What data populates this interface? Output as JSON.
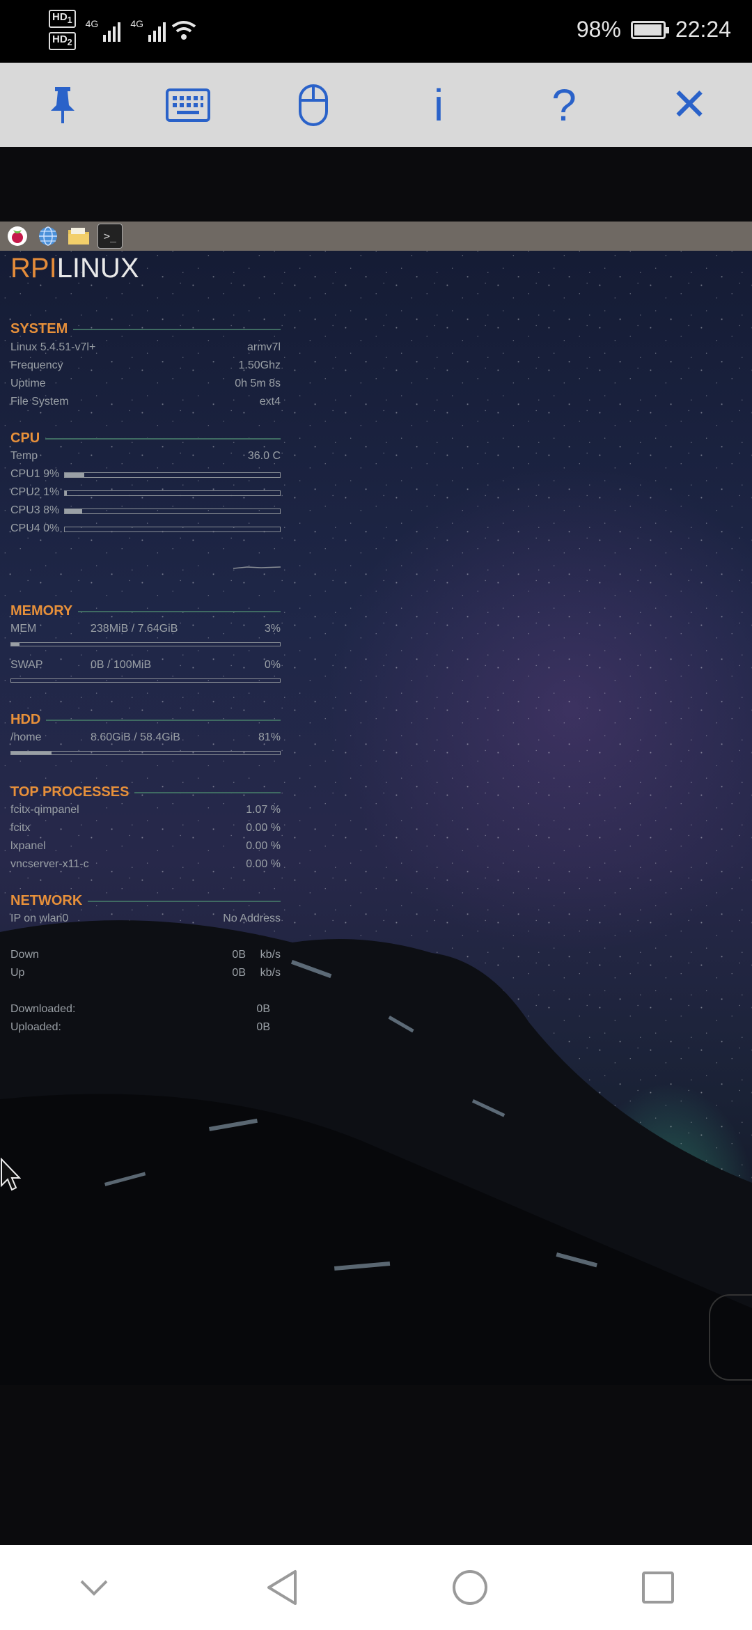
{
  "status_bar": {
    "sim1": "HD",
    "sim1_slot": "1",
    "sim2": "HD",
    "sim2_slot": "2",
    "network1": "4G",
    "network2": "4G",
    "battery_percent": "98%",
    "battery_level": 0.98,
    "time": "22:24"
  },
  "toolbar": {
    "buttons": [
      {
        "icon": "pin-icon"
      },
      {
        "icon": "keyboard-icon"
      },
      {
        "icon": "mouse-icon"
      },
      {
        "icon": "info-icon",
        "glyph": "i"
      },
      {
        "icon": "help-icon",
        "glyph": "?"
      },
      {
        "icon": "close-icon",
        "glyph": "✕"
      }
    ]
  },
  "desktop": {
    "taskbar": [
      {
        "icon": "raspberry-icon"
      },
      {
        "icon": "globe-icon"
      },
      {
        "icon": "folder-icon"
      },
      {
        "icon": "terminal-icon",
        "glyph": ">_"
      }
    ],
    "brand": {
      "part1": "RPI",
      "part2": "LINUX"
    },
    "system": {
      "title": "SYSTEM",
      "rows": [
        {
          "label": "Linux 5.4.51-v7l+",
          "value": "armv7l"
        },
        {
          "label": "Frequency",
          "value": "1.50Ghz"
        },
        {
          "label": "Uptime",
          "value": "0h 5m 8s"
        },
        {
          "label": "File System",
          "value": "ext4"
        }
      ]
    },
    "cpu": {
      "title": "CPU",
      "temp_label": "Temp",
      "temp_value": "36.0 C",
      "cores": [
        {
          "label": "CPU1 9%",
          "level": 0.09
        },
        {
          "label": "CPU2 1%",
          "level": 0.01
        },
        {
          "label": "CPU3 8%",
          "level": 0.08
        },
        {
          "label": "CPU4 0%",
          "level": 0.0
        }
      ]
    },
    "memory": {
      "title": "MEMORY",
      "mem_label": "MEM",
      "mem_used": "238MiB / 7.64GiB",
      "mem_percent": "3%",
      "mem_level": 0.03,
      "swap_label": "SWAP",
      "swap_used": "0B / 100MiB",
      "swap_percent": "0%",
      "swap_level": 0.0
    },
    "hdd": {
      "title": "HDD",
      "mount": "/home",
      "used": "8.60GiB / 58.4GiB",
      "percent": "81%",
      "level": 0.15
    },
    "processes": {
      "title": "TOP PROCESSES",
      "rows": [
        {
          "name": "fcitx-qimpanel",
          "value": "1.07 %"
        },
        {
          "name": "fcitx",
          "value": "0.00 %"
        },
        {
          "name": "lxpanel",
          "value": "0.00 %"
        },
        {
          "name": "vncserver-x11-c",
          "value": "0.00 %"
        }
      ]
    },
    "network": {
      "title": "NETWORK",
      "ip_label": "IP on wlan0",
      "ip_value": "No Address",
      "down_label": "Down",
      "down_value": "0B",
      "down_unit": "kb/s",
      "up_label": "Up",
      "up_value": "0B",
      "up_unit": "kb/s",
      "downloaded_label": "Downloaded:",
      "downloaded_value": "0B",
      "uploaded_label": "Uploaded:",
      "uploaded_value": "0B"
    }
  },
  "nav_bar": [
    {
      "icon": "chevron-down-icon"
    },
    {
      "icon": "back-icon"
    },
    {
      "icon": "home-icon"
    },
    {
      "icon": "recents-icon"
    }
  ]
}
